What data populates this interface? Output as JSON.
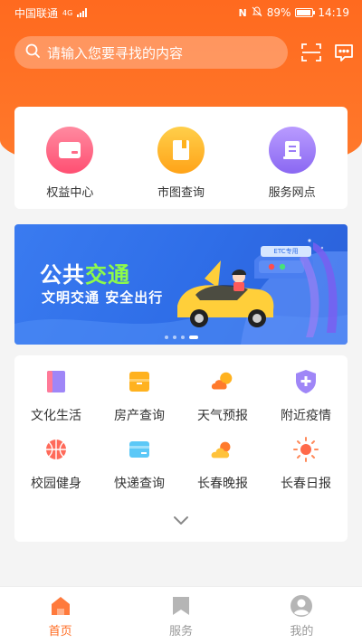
{
  "status_bar": {
    "carrier": "中国联通",
    "network": "4G",
    "battery": "89%",
    "time": "14:19"
  },
  "search": {
    "placeholder": "请输入您要寻找的内容"
  },
  "quick_links": [
    {
      "label": "权益中心",
      "icon": "card-icon",
      "color": "#ff5f7e"
    },
    {
      "label": "市图查询",
      "icon": "book-icon",
      "color": "#ffb21f"
    },
    {
      "label": "服务网点",
      "icon": "outlet-icon",
      "color": "#9b7cf7"
    }
  ],
  "banner": {
    "title_part1": "公共",
    "title_part2": "交通",
    "subtitle": "文明交通 安全出行",
    "sign": "ETC专用",
    "slide_count": 4,
    "active_slide": 4
  },
  "services": [
    {
      "label": "文化生活",
      "icon": "culture-icon"
    },
    {
      "label": "房产查询",
      "icon": "house-icon"
    },
    {
      "label": "天气预报",
      "icon": "weather-icon"
    },
    {
      "label": "附近疫情",
      "icon": "shield-plus-icon"
    },
    {
      "label": "校园健身",
      "icon": "basketball-icon"
    },
    {
      "label": "快递查询",
      "icon": "package-icon"
    },
    {
      "label": "长春晚报",
      "icon": "evening-news-icon"
    },
    {
      "label": "长春日报",
      "icon": "sun-news-icon"
    }
  ],
  "tabs": [
    {
      "label": "首页",
      "active": true
    },
    {
      "label": "服务",
      "active": false
    },
    {
      "label": "我的",
      "active": false
    }
  ],
  "colors": {
    "brand": "#ff6a1f",
    "banner": "#2f6ee8"
  }
}
